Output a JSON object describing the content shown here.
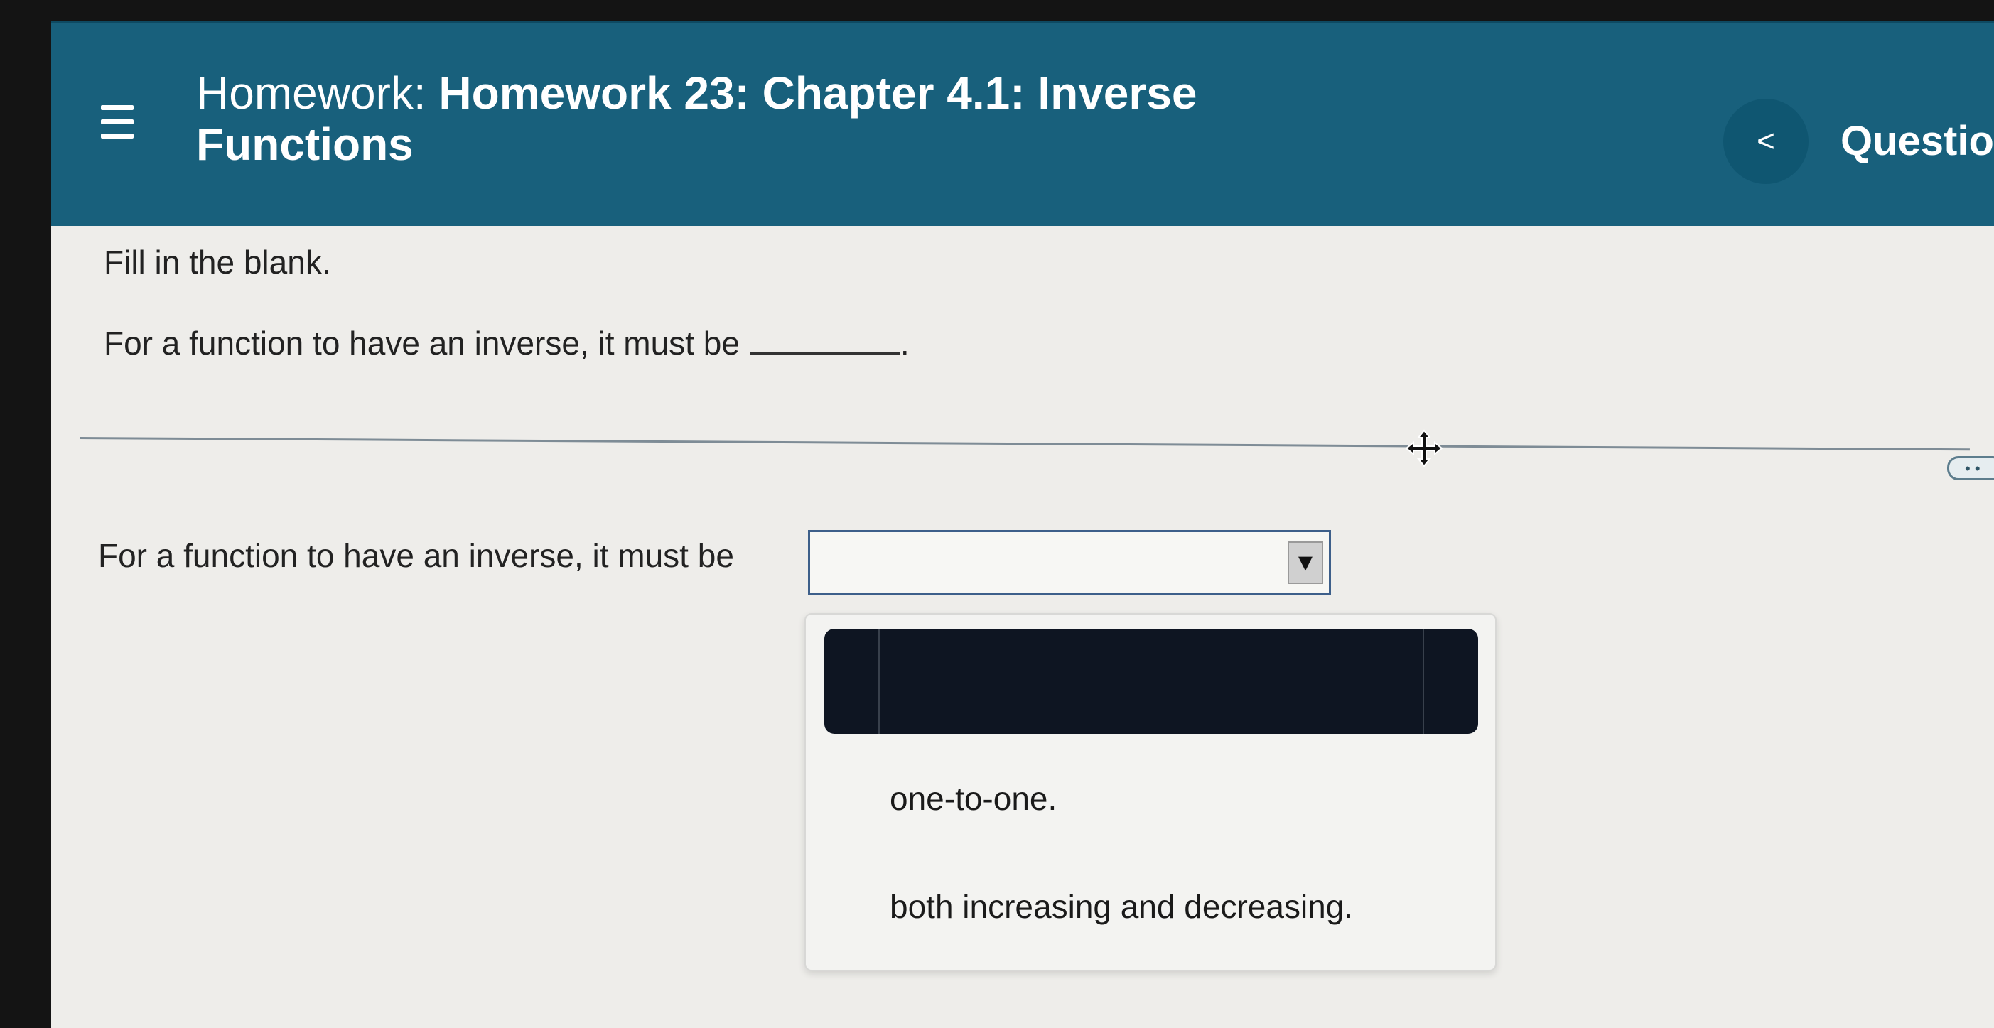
{
  "header": {
    "title_prefix": "Homework:",
    "title_name": "Homework 23: Chapter 4.1: Inverse Functions",
    "question_label": "Questio",
    "prev_label": "<"
  },
  "question": {
    "instruction": "Fill in the blank.",
    "prompt": "For a function to have an inverse, it must be",
    "prompt_end": ".",
    "answer_prompt": "For a function to have an inverse, it must be"
  },
  "dropdown": {
    "selected_value": "",
    "arrow_glyph": "▼",
    "options": [
      {
        "label": ""
      },
      {
        "label": "one-to-one."
      },
      {
        "label": "both increasing and decreasing."
      }
    ]
  },
  "edge_handle_label": "• •",
  "icons": {
    "menu": "hamburger-menu-icon",
    "move": "move-cursor-icon",
    "prev": "chevron-left-icon"
  },
  "colors": {
    "header_bg": "#18607c",
    "highlight_bg": "#0e1522",
    "select_border": "#3d5f8a"
  }
}
